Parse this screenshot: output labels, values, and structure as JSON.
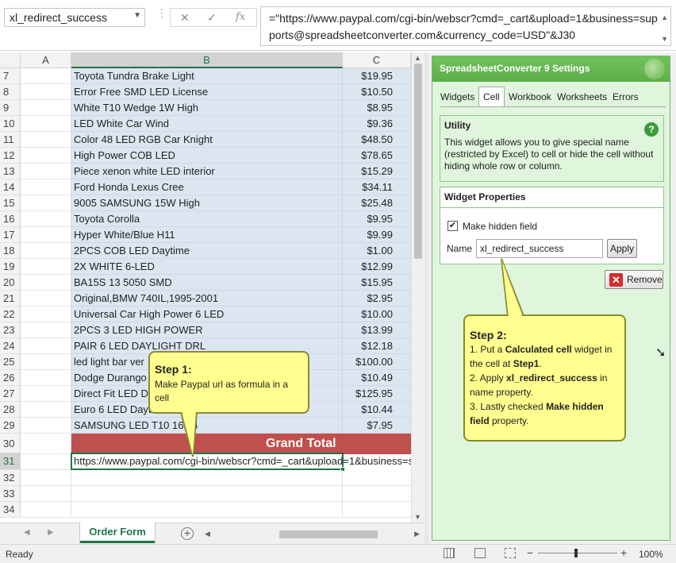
{
  "formula_bar": {
    "name_box": "xl_redirect_success",
    "formula": "=\"https://www.paypal.com/cgi-bin/webscr?cmd=_cart&upload=1&business=supports@spreadsheetconverter.com&currency_code=USD\"&J30",
    "fx_label": "fx",
    "cancel_icon": "x-icon",
    "enter_icon": "check-icon"
  },
  "grid": {
    "columns": [
      "A",
      "B",
      "C"
    ],
    "rows": [
      {
        "num": "7",
        "item": "Toyota Tundra Brake Light",
        "price": "$19.95"
      },
      {
        "num": "8",
        "item": "Error Free SMD LED License",
        "price": "$10.50"
      },
      {
        "num": "9",
        "item": "White T10 Wedge 1W High",
        "price": "$8.95"
      },
      {
        "num": "10",
        "item": "LED White Car Wind",
        "price": "$9.36"
      },
      {
        "num": "11",
        "item": "Color 48 LED RGB Car Knight",
        "price": "$48.50"
      },
      {
        "num": "12",
        "item": "High Power COB LED",
        "price": "$78.65"
      },
      {
        "num": "13",
        "item": "Piece xenon white LED interior",
        "price": "$15.29"
      },
      {
        "num": "14",
        "item": "Ford Honda Lexus Cree",
        "price": "$34.11"
      },
      {
        "num": "15",
        "item": "9005 SAMSUNG 15W High",
        "price": "$25.48"
      },
      {
        "num": "16",
        "item": "Toyota Corolla",
        "price": "$9.95"
      },
      {
        "num": "17",
        "item": "Hyper White/Blue H11",
        "price": "$9.99"
      },
      {
        "num": "18",
        "item": "2PCS COB LED Daytime",
        "price": "$1.00"
      },
      {
        "num": "19",
        "item": "2X WHITE 6-LED",
        "price": "$12.99"
      },
      {
        "num": "20",
        "item": "BA15S 13 5050 SMD",
        "price": "$15.95"
      },
      {
        "num": "21",
        "item": "Original,BMW 740IL,1995-2001",
        "price": "$2.95"
      },
      {
        "num": "22",
        "item": "Universal Car High Power 6 LED",
        "price": "$10.00"
      },
      {
        "num": "23",
        "item": "2PCS 3 LED HIGH POWER",
        "price": "$13.99"
      },
      {
        "num": "24",
        "item": "PAIR 6 LED DAYLIGHT DRL",
        "price": "$12.18"
      },
      {
        "num": "25",
        "item": "led light bar ver",
        "price": "$100.00"
      },
      {
        "num": "26",
        "item": " Dodge Durango",
        "price": "$10.49"
      },
      {
        "num": "27",
        "item": "Direct Fit LED D",
        "price": "$125.95"
      },
      {
        "num": "28",
        "item": "Euro 6 LED Dayt",
        "price": "$10.44"
      },
      {
        "num": "29",
        "item": "SAMSUNG LED T10 16       94",
        "price": "$7.95"
      }
    ],
    "grand_total_row": "30",
    "grand_total_label": "Grand Total",
    "url_row": "31",
    "url_value": "https://www.paypal.com/cgi-bin/webscr?cmd=_cart&upload=1&business=supports@spreadsheetconverter.com",
    "empty_rows": [
      "32",
      "33",
      "34"
    ]
  },
  "sheet_tabs": {
    "active": "Order Form",
    "add_icon": "plus-circle-icon"
  },
  "status_bar": {
    "status": "Ready",
    "zoom": "100%",
    "zoom_minus": "−",
    "zoom_plus": "+"
  },
  "pane": {
    "title": "SpreadsheetConverter 9 Settings",
    "tabs": [
      "Widgets",
      "Cell",
      "Workbook",
      "Worksheets",
      "Errors"
    ],
    "active_tab": "Cell",
    "utility": {
      "heading": "Utility",
      "text": "This widget allows you to give special name (restricted by Excel) to cell or hide the cell without hiding whole row or column.",
      "help_icon": "?"
    },
    "widget_properties": {
      "heading": "Widget Properties",
      "hidden_field_label": "Make hidden field",
      "hidden_field_checked": true,
      "name_label": "Name",
      "name_value": "xl_redirect_success",
      "apply_label": "Apply"
    },
    "remove_label": "Remove"
  },
  "callouts": {
    "step1": {
      "title": "Step 1:",
      "body": "Make Paypal url as formula in  a cell"
    },
    "step2": {
      "title": "Step 2:",
      "lines": [
        [
          {
            "t": "1. Put a "
          },
          {
            "t": "Calculated cell",
            "b": true
          },
          {
            "t": " widget in the cell at "
          },
          {
            "t": "Step1",
            "b": true
          },
          {
            "t": "."
          }
        ],
        [
          {
            "t": "2. Apply "
          },
          {
            "t": "xl_redirect_success",
            "b": true
          },
          {
            "t": " in name property."
          }
        ],
        [
          {
            "t": "3. Lastly checked "
          },
          {
            "t": "Make hidden field",
            "b": true
          },
          {
            "t": " property."
          }
        ]
      ]
    }
  },
  "colors": {
    "accent_green": "#217346",
    "selection_fill": "#dce6f1",
    "grand_total_fill": "#c0504d",
    "pane_bg": "#dff5dc",
    "callout_fill": "#ffff8f"
  }
}
